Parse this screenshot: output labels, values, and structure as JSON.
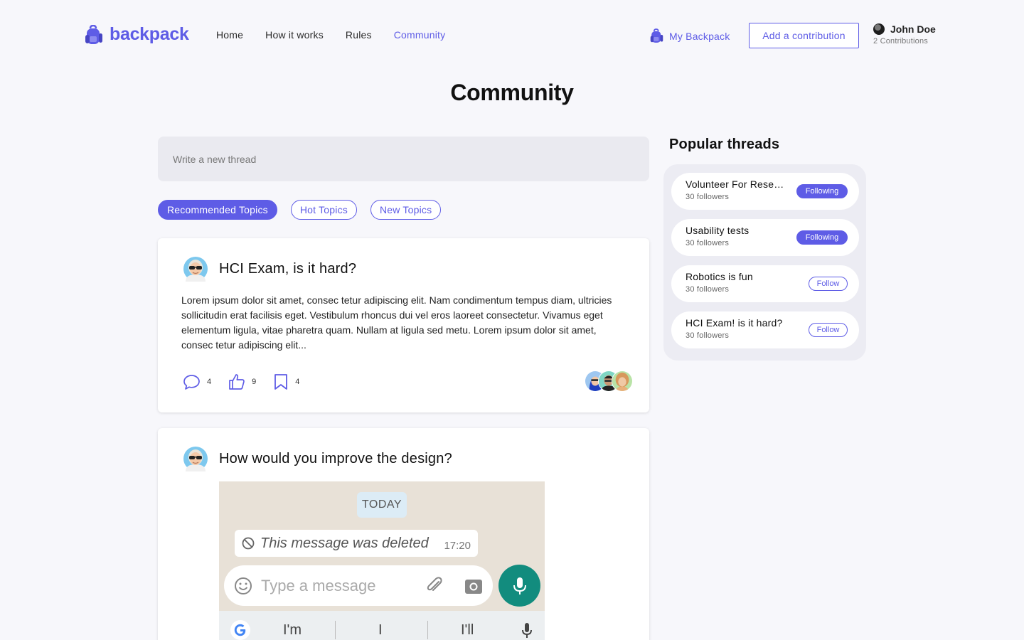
{
  "brand": {
    "name": "backpack",
    "accent": "#5e5ce6"
  },
  "nav": {
    "items": [
      {
        "label": "Home",
        "active": false
      },
      {
        "label": "How it works",
        "active": false
      },
      {
        "label": "Rules",
        "active": false
      },
      {
        "label": "Community",
        "active": true
      }
    ]
  },
  "header": {
    "my_backpack": "My Backpack",
    "add_contribution": "Add a contribution",
    "user": {
      "name": "John Doe",
      "contributions": "2 Contributions"
    }
  },
  "page": {
    "title": "Community"
  },
  "composer": {
    "placeholder": "Write a new thread"
  },
  "filters": [
    {
      "label": "Recommended Topics",
      "active": true
    },
    {
      "label": "Hot Topics",
      "active": false
    },
    {
      "label": "New Topics",
      "active": false
    }
  ],
  "posts": [
    {
      "title": "HCI Exam, is it hard?",
      "body": "Lorem ipsum dolor sit amet, consec tetur adipiscing elit. Nam condimentum tempus diam, ultricies sollicitudin erat facilisis eget. Vestibulum rhoncus dui vel eros laoreet consectetur. Vivamus eget elementum ligula, vitae pharetra quam. Nullam at ligula sed metu. Lorem ipsum dolor sit amet, consec tetur adipiscing elit...",
      "comments": "4",
      "likes": "9",
      "bookmarks": "4"
    },
    {
      "title": "How would you improve the design?",
      "screenshot": {
        "date_chip": "TODAY",
        "deleted_message": "This message was deleted",
        "deleted_time": "17:20",
        "input_placeholder": "Type a message",
        "suggestions": [
          "I'm",
          "I",
          "I'll"
        ]
      }
    }
  ],
  "sidebar": {
    "title": "Popular threads",
    "threads": [
      {
        "name": "Volunteer For Research",
        "followers": "30 followers",
        "button": "Following",
        "following": true
      },
      {
        "name": "Usability tests",
        "followers": "30 followers",
        "button": "Following",
        "following": true
      },
      {
        "name": "Robotics is fun",
        "followers": "30 followers",
        "button": "Follow",
        "following": false
      },
      {
        "name": "HCI Exam! is it hard?",
        "followers": "30 followers",
        "button": "Follow",
        "following": false
      }
    ]
  }
}
